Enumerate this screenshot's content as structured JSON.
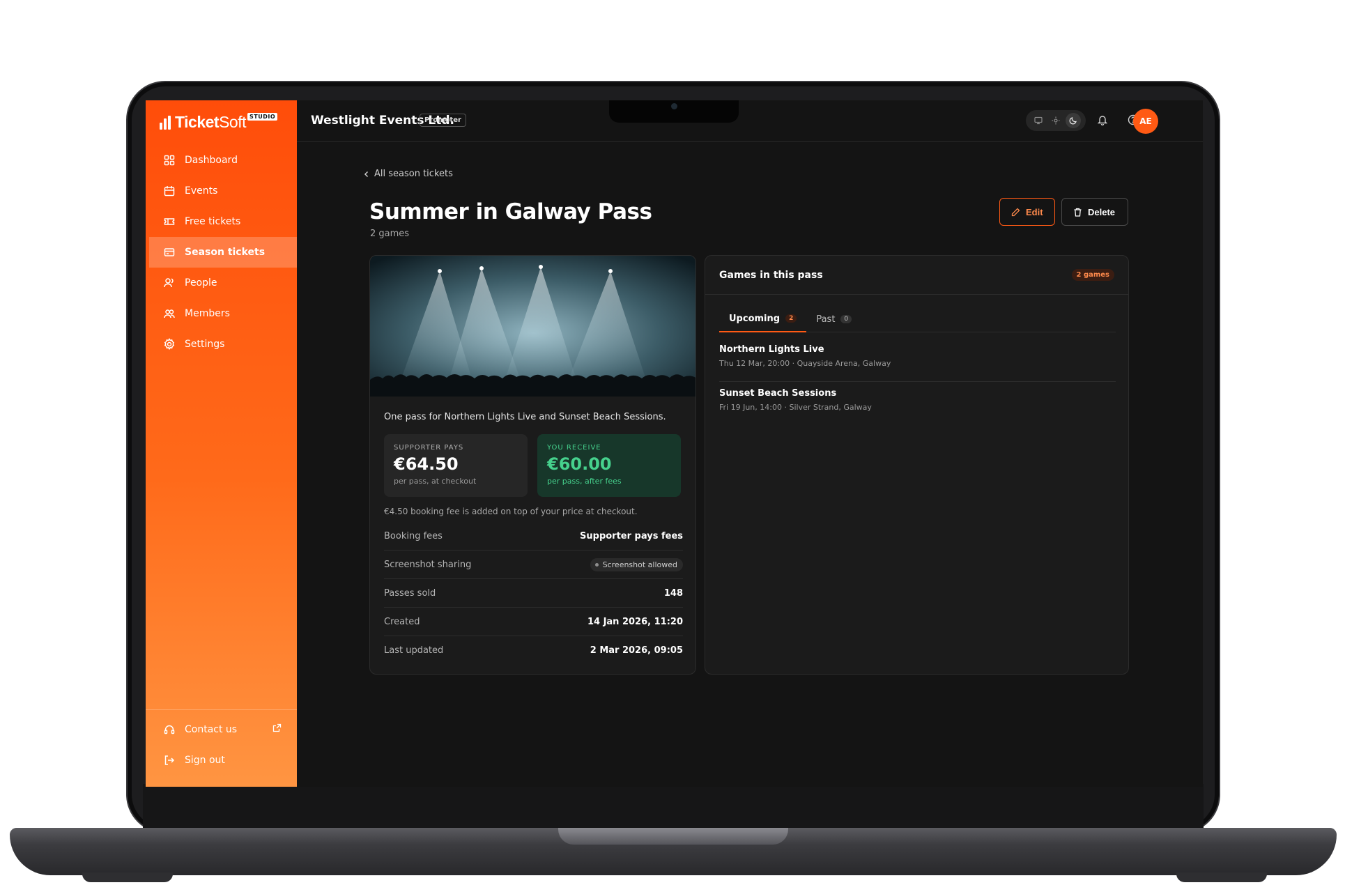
{
  "sidebar": {
    "logo_bold": "Ticket",
    "logo_light": "Soft",
    "badge": "STUDIO",
    "items": [
      {
        "label": "Dashboard",
        "icon": "grid-icon"
      },
      {
        "label": "Events",
        "icon": "calendar-icon"
      },
      {
        "label": "Free tickets",
        "icon": "ticket-icon"
      },
      {
        "label": "Season tickets",
        "icon": "card-icon",
        "active": true
      },
      {
        "label": "People",
        "icon": "user-icon"
      },
      {
        "label": "Members",
        "icon": "users-icon"
      },
      {
        "label": "Settings",
        "icon": "gear-icon"
      }
    ],
    "bottom": [
      {
        "label": "Contact us",
        "icon": "headset-icon"
      },
      {
        "label": "Sign out",
        "icon": "logout-icon"
      }
    ]
  },
  "topbar": {
    "org_name": "Westlight Events Ltd.",
    "role_badge": "Promoter",
    "avatar_initials": "AE"
  },
  "page": {
    "back_label": "All season tickets",
    "title": "Summer in Galway Pass",
    "subtitle": "2 games",
    "edit_label": "Edit",
    "delete_label": "Delete"
  },
  "pass": {
    "description": "One pass for Northern Lights Live and Sunset Beach Sessions.",
    "supporter_label": "SUPPORTER PAYS",
    "supporter_amount": "€64.50",
    "supporter_sub": "per pass, at checkout",
    "receive_label": "YOU RECEIVE",
    "receive_amount": "€60.00",
    "receive_sub": "per pass, after fees",
    "fee_note": "€4.50 booking fee is added on top of your price at checkout.",
    "rows": [
      {
        "label": "Booking fees",
        "value": "Supporter pays fees"
      },
      {
        "label": "Screenshot sharing",
        "value": "Screenshot allowed"
      },
      {
        "label": "Passes sold",
        "value": "148"
      },
      {
        "label": "Created",
        "value": "14 Jan 2026, 11:20"
      },
      {
        "label": "Last updated",
        "value": "2 Mar 2026, 09:05"
      }
    ]
  },
  "games_card": {
    "title": "Games in this pass",
    "count_badge": "2 games",
    "tabs": [
      {
        "label": "Upcoming",
        "count": "2"
      },
      {
        "label": "Past",
        "count": "0"
      }
    ],
    "games": [
      {
        "title": "Northern Lights Live",
        "meta": "Thu 12 Mar, 20:00 · Quayside Arena, Galway"
      },
      {
        "title": "Sunset Beach Sessions",
        "meta": "Fri 19 Jun, 14:00 · Silver Strand, Galway"
      }
    ]
  },
  "colors": {
    "accent": "#ff5a14",
    "positive": "#46d18d",
    "background": "#141414"
  }
}
